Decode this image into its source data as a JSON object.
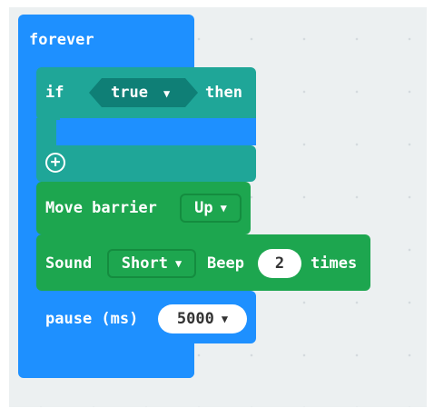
{
  "forever": {
    "label": "forever"
  },
  "if_block": {
    "if_label": "if",
    "condition": "true",
    "then_label": "then",
    "add_symbol": "+"
  },
  "move_block": {
    "label": "Move barrier",
    "direction": "Up"
  },
  "sound_block": {
    "label": "Sound",
    "type": "Short",
    "beep_label": "Beep",
    "count": "2",
    "times_label": "times"
  },
  "pause_block": {
    "label": "pause (ms)",
    "duration": "5000"
  },
  "icons": {
    "dropdown": "dropdown-caret-icon",
    "add": "add-circle-icon"
  },
  "colors": {
    "loop_blue": "#1e90ff",
    "logic_teal": "#1fa698",
    "logic_dark": "#0f7f76",
    "action_green": "#1da64f",
    "workspace_bg": "#ecf0f1"
  }
}
